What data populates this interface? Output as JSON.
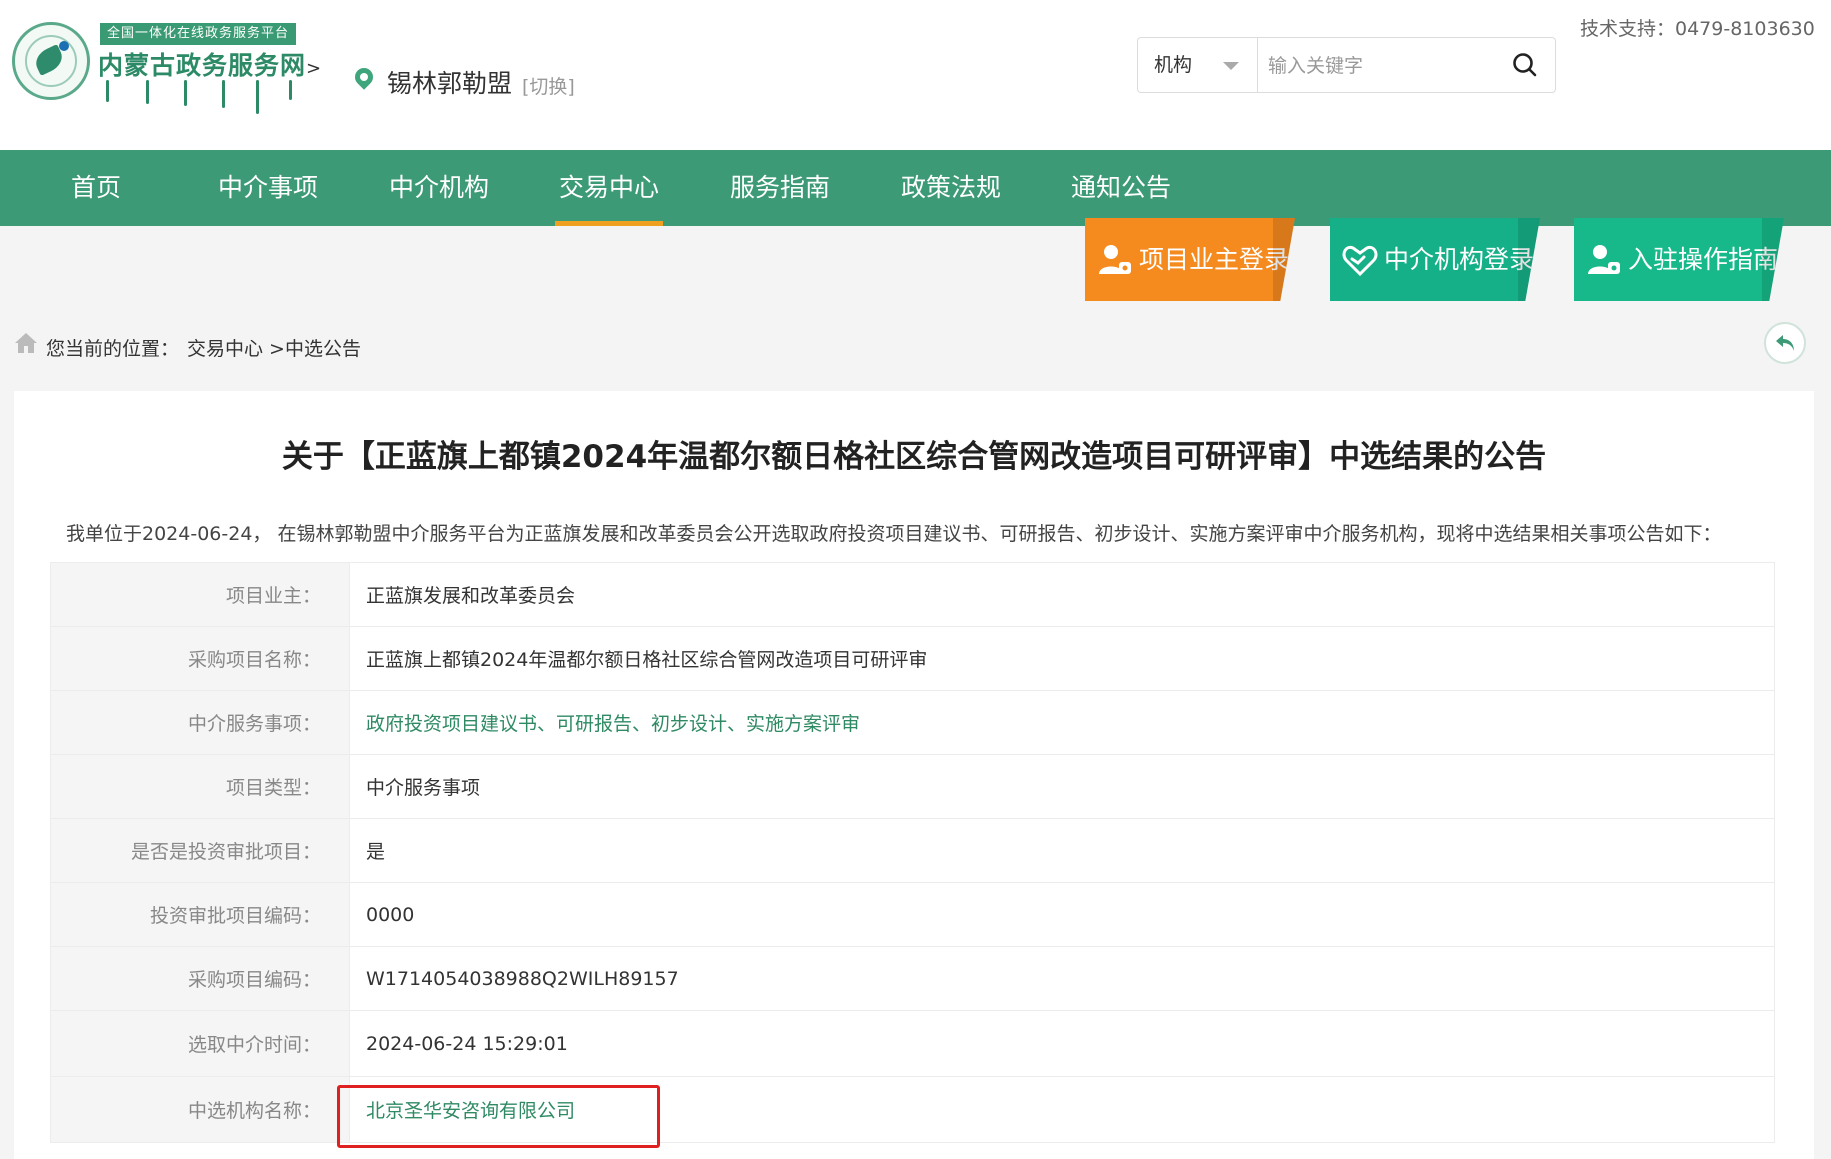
{
  "header": {
    "logo_banner": "全国一体化在线政务服务平台",
    "logo_title": "内蒙古政务服务网",
    "logo_arrow": ">",
    "location": "锡林郭勒盟",
    "location_switch": "[切换]",
    "tech_support": "技术支持：0479-8103630"
  },
  "search": {
    "category": "机构",
    "placeholder": "输入关键字"
  },
  "nav": {
    "items": [
      {
        "label": "首页"
      },
      {
        "label": "中介事项"
      },
      {
        "label": "中介机构"
      },
      {
        "label": "交易中心"
      },
      {
        "label": "服务指南"
      },
      {
        "label": "政策法规"
      },
      {
        "label": "通知公告"
      }
    ],
    "active": "交易中心",
    "color": "#3d9a76",
    "active_underline": "#f0a020"
  },
  "login_buttons": {
    "owner": "项目业主登录",
    "agency": "中介机构登录",
    "guide": "入驻操作指南"
  },
  "breadcrumb": {
    "label": "您当前的位置：",
    "path": "交易中心 >中选公告"
  },
  "announcement": {
    "title": "关于【正蓝旗上都镇2024年温都尔额日格社区综合管网改造项目可研评审】中选结果的公告",
    "intro": "我单位于2024-06-24， 在锡林郭勒盟中介服务平台为正蓝旗发展和改革委员会公开选取政府投资项目建议书、可研报告、初步设计、实施方案评审中介服务机构，现将中选结果相关事项公告如下：",
    "rows": [
      {
        "label": "项目业主：",
        "value": "正蓝旗发展和改革委员会"
      },
      {
        "label": "采购项目名称：",
        "value": "正蓝旗上都镇2024年温都尔额日格社区综合管网改造项目可研评审"
      },
      {
        "label": "中介服务事项：",
        "value": "政府投资项目建议书、可研报告、初步设计、实施方案评审"
      },
      {
        "label": "项目类型：",
        "value": "中介服务事项"
      },
      {
        "label": "是否是投资审批项目：",
        "value": "是"
      },
      {
        "label": "投资审批项目编码：",
        "value": "0000"
      },
      {
        "label": "采购项目编码：",
        "value": "W1714054038988Q2WILH89157"
      },
      {
        "label": "选取中介时间：",
        "value": "2024-06-24 15:29:01"
      },
      {
        "label": "中选机构名称：",
        "value": "北京圣华安咨询有限公司"
      }
    ]
  },
  "colors": {
    "brand_green": "#3d9a76",
    "link_green": "#2f8a64",
    "owner_orange": "#f58a1f",
    "agency_teal": "#16b088",
    "highlight_red": "#e02020"
  }
}
